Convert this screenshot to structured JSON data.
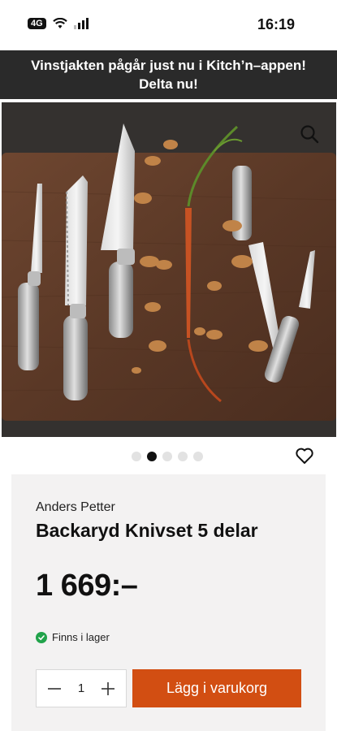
{
  "status_bar": {
    "network": "4G",
    "time": "16:19"
  },
  "banner": {
    "text": "Vinstjakten pågår just nu i Kitch’n–appen! Delta nu!"
  },
  "gallery": {
    "image_count": 5,
    "active_index": 1,
    "zoom_icon": "search-icon",
    "favorite_icon": "heart-icon"
  },
  "product": {
    "brand": "Anders Petter",
    "title": "Backaryd Knivset 5 delar",
    "price": "1 669:–",
    "stock_text": "Finns i lager",
    "stock_color": "#21a34b"
  },
  "purchase": {
    "quantity": "1",
    "add_to_cart_label": "Lägg i varukorg",
    "accent_color": "#d24e12"
  }
}
